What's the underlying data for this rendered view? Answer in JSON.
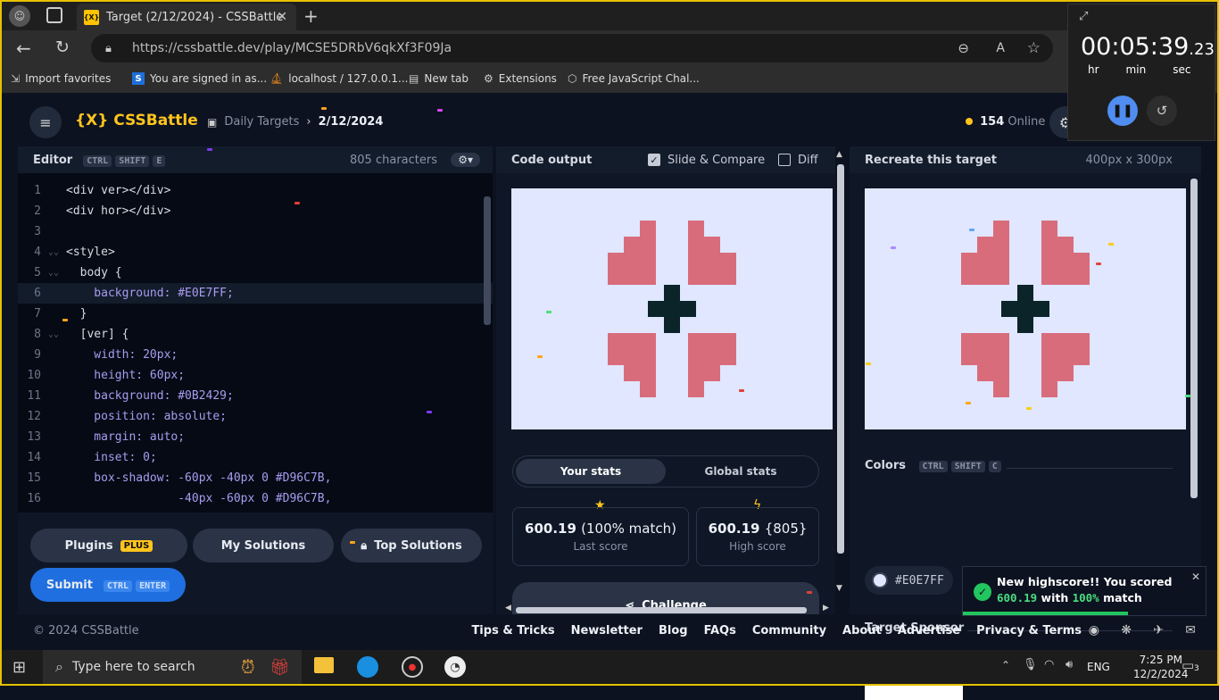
{
  "browser": {
    "tab_title": "Target (2/12/2024) - CSSBattle",
    "tab_icon": "{X}",
    "url": "https://cssbattle.dev/play/MCSE5DRbV6qkXf3F09Ja",
    "favorites": [
      "Import favorites",
      "You are signed in as...",
      "localhost / 127.0.0.1...",
      "New tab",
      "Extensions",
      "Free JavaScript Chal..."
    ]
  },
  "timer": {
    "value": "00:05:39",
    "fraction": ".23",
    "labels": [
      "hr",
      "min",
      "sec"
    ]
  },
  "header": {
    "logo": "{X} CSSBattle",
    "crumb": "Daily Targets",
    "date": "2/12/2024",
    "online_count": "154",
    "online_label": "Online"
  },
  "editor": {
    "title": "Editor",
    "keys": [
      "CTRL",
      "SHIFT",
      "E"
    ],
    "char_count": "805 characters",
    "lines": [
      {
        "n": "1",
        "fold": "",
        "code": "<div ver></div>",
        "cls": "t-tag"
      },
      {
        "n": "2",
        "fold": "",
        "code": "<div hor></div>",
        "cls": "t-tag"
      },
      {
        "n": "3",
        "fold": "",
        "code": "",
        "cls": "t-tag"
      },
      {
        "n": "4",
        "fold": "⌄⌄",
        "code": "<style>",
        "cls": "t-tag"
      },
      {
        "n": "5",
        "fold": "⌄⌄",
        "code": "  body {",
        "cls": "t-sel"
      },
      {
        "n": "6",
        "fold": "",
        "code": "    background: #E0E7FF;",
        "cls": "t-prop"
      },
      {
        "n": "7",
        "fold": "",
        "code": "  }",
        "cls": "t-sel"
      },
      {
        "n": "8",
        "fold": "⌄⌄",
        "code": "  [ver] {",
        "cls": "t-sel"
      },
      {
        "n": "9",
        "fold": "",
        "code": "    width: 20px;",
        "cls": "t-prop"
      },
      {
        "n": "10",
        "fold": "",
        "code": "    height: 60px;",
        "cls": "t-prop"
      },
      {
        "n": "11",
        "fold": "",
        "code": "    background: #0B2429;",
        "cls": "t-prop"
      },
      {
        "n": "12",
        "fold": "",
        "code": "    position: absolute;",
        "cls": "t-prop"
      },
      {
        "n": "13",
        "fold": "",
        "code": "    margin: auto;",
        "cls": "t-prop"
      },
      {
        "n": "14",
        "fold": "",
        "code": "    inset: 0;",
        "cls": "t-prop"
      },
      {
        "n": "15",
        "fold": "",
        "code": "    box-shadow: -60px -40px 0 #D96C7B,",
        "cls": "t-prop"
      },
      {
        "n": "16",
        "fold": "",
        "code": "                -40px -60px 0 #D96C7B,",
        "cls": "t-prop"
      }
    ],
    "plugins_label": "Plugins",
    "plus_badge": "PLUS",
    "my_solutions_label": "My Solutions",
    "top_solutions_label": "Top Solutions",
    "submit_label": "Submit",
    "submit_keys": [
      "CTRL",
      "ENTER"
    ]
  },
  "output": {
    "title": "Code output",
    "slide_compare_label": "Slide & Compare",
    "slide_compare_checked": true,
    "diff_label": "Diff",
    "diff_checked": false,
    "your_stats_label": "Your stats",
    "global_stats_label": "Global stats",
    "last_score_value": "600.19",
    "last_score_match": "(100% match)",
    "last_score_label": "Last score",
    "high_score_value": "600.19",
    "high_score_chars": "{805}",
    "high_score_label": "High score",
    "challenge_label": "Challenge"
  },
  "target": {
    "title": "Recreate this target",
    "size": "400px x 300px",
    "colors_label": "Colors",
    "colors_keys": [
      "CTRL",
      "SHIFT",
      "C"
    ],
    "colors": [
      {
        "hex": "#E0E7FF",
        "swatch": "#E0E7FF"
      },
      {
        "hex": "#D96C7B",
        "swatch": "#D96C7B"
      },
      {
        "hex": "#0B2429",
        "swatch": "#0B2429"
      }
    ],
    "sponsor_label": "Target Sponsor"
  },
  "toast": {
    "line1": "New highscore!! You scored",
    "score": "600.19",
    "mid": "with",
    "match": "100%",
    "tail": "match",
    "progress": 0.68
  },
  "footer": {
    "copyright": "© 2024 CSSBattle",
    "links": [
      "Tips & Tricks",
      "Newsletter",
      "Blog",
      "FAQs",
      "Community",
      "About",
      "Advertise",
      "Privacy & Terms"
    ]
  },
  "taskbar": {
    "search_placeholder": "Type here to search",
    "language": "ENG",
    "time": "7:25 PM",
    "date": "12/2/2024",
    "notification_count": "3"
  },
  "art_colors": {
    "bg": "#E0E7FF",
    "pink": "#D96C7B",
    "dark": "#0B2429"
  }
}
